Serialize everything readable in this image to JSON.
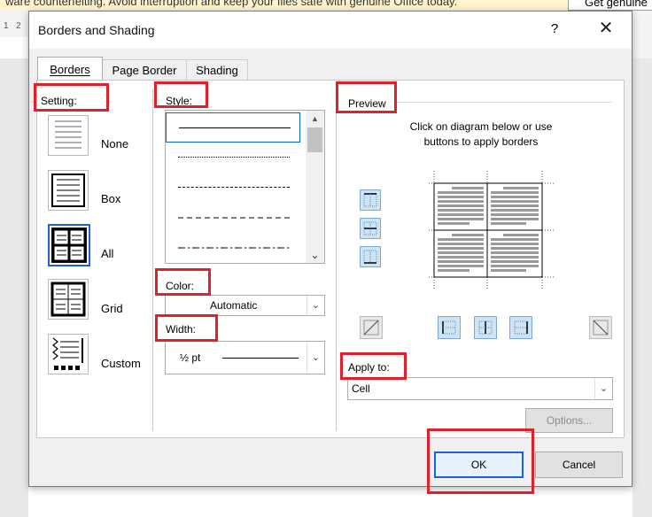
{
  "background": {
    "banner_text": "ware counterfeiting. Avoid interruption and keep your files safe with genuine Office today.",
    "banner_button": "Get genuine",
    "ruler_marks": [
      "1",
      "2"
    ]
  },
  "dialog": {
    "title": "Borders and Shading",
    "help_label": "?",
    "close_label": "✕"
  },
  "tabs": [
    {
      "label": "Borders",
      "active": true
    },
    {
      "label": "Page Border",
      "active": false
    },
    {
      "label": "Shading",
      "active": false
    }
  ],
  "setting": {
    "label": "Setting:",
    "items": [
      {
        "label": "None",
        "icon": "setting-none-icon"
      },
      {
        "label": "Box",
        "icon": "setting-box-icon"
      },
      {
        "label": "All",
        "icon": "setting-all-icon",
        "selected": true
      },
      {
        "label": "Grid",
        "icon": "setting-grid-icon"
      },
      {
        "label": "Custom",
        "icon": "setting-custom-icon"
      }
    ]
  },
  "style": {
    "label": "Style:",
    "selected_index": 0,
    "options": [
      "solid",
      "dotted",
      "small-dashed",
      "dashed",
      "dash-dot"
    ]
  },
  "color": {
    "label": "Color:",
    "value": "Automatic"
  },
  "width": {
    "label": "Width:",
    "value": "½ pt"
  },
  "preview": {
    "label": "Preview",
    "instruction_line1": "Click on diagram below or use",
    "instruction_line2": "buttons to apply borders"
  },
  "apply_to": {
    "label": "Apply to:",
    "value": "Cell"
  },
  "buttons": {
    "options": "Options...",
    "ok": "OK",
    "cancel": "Cancel"
  },
  "colors": {
    "highlight_red": "#e0202a",
    "selection_blue": "#1e63d6",
    "toggle_bg": "#cce4f7"
  }
}
